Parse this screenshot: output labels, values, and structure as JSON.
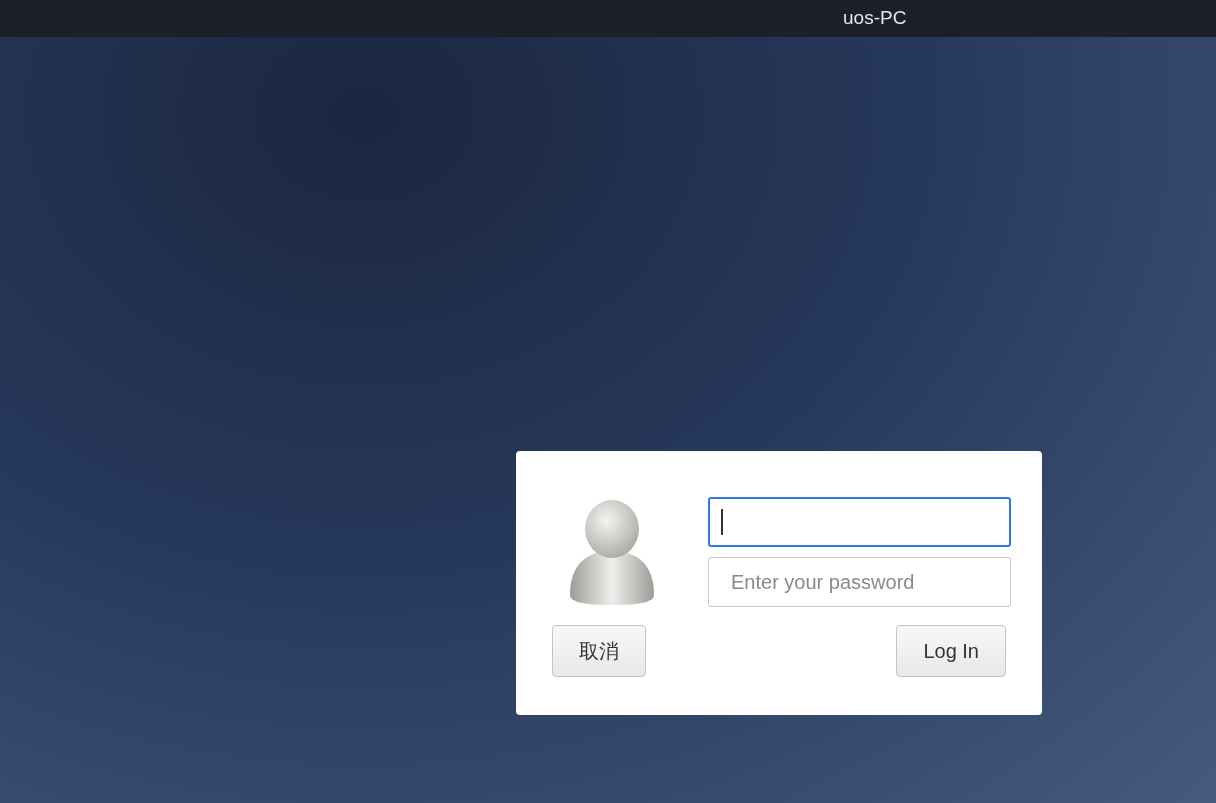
{
  "top_bar": {
    "title": "uos-PC"
  },
  "login_dialog": {
    "fields": [
      {
        "focused": true
      },
      {
        "placeholder": "Enter your password",
        "focused": false
      }
    ],
    "buttons": [
      {
        "label": "取消"
      },
      {
        "label": "Log In"
      }
    ]
  }
}
